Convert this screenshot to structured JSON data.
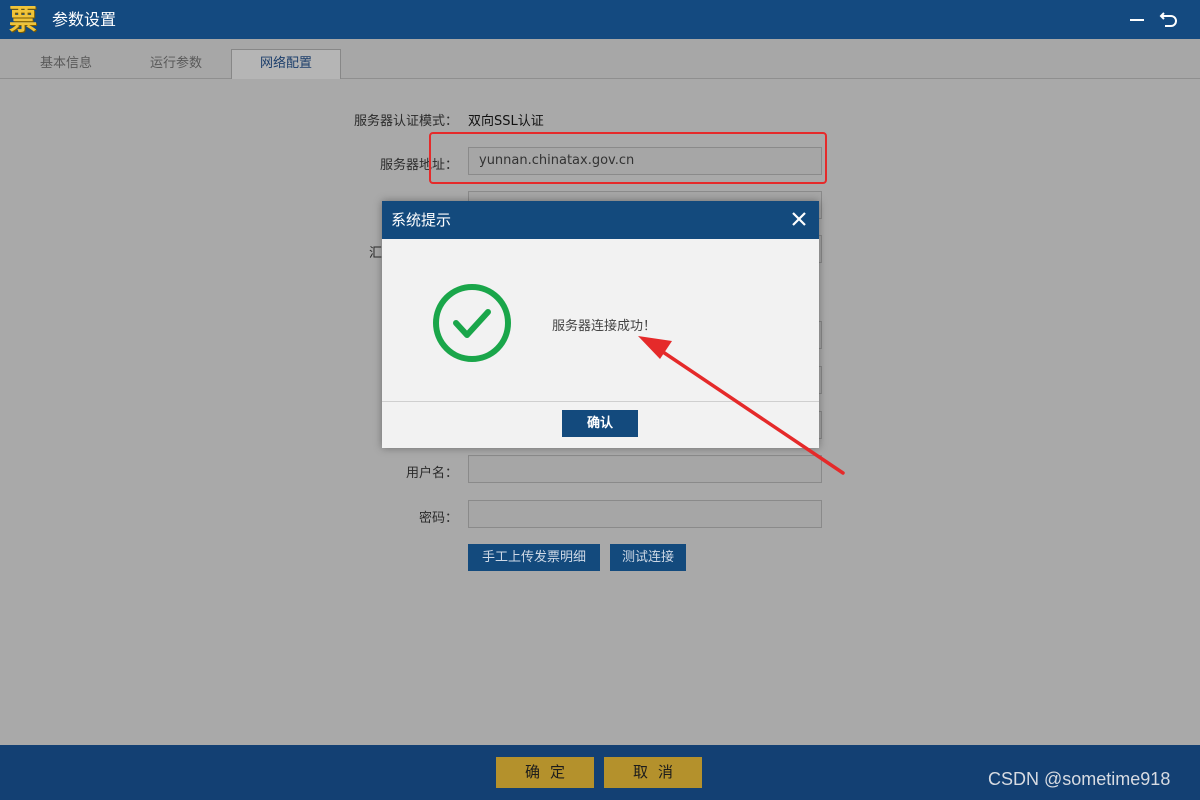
{
  "window": {
    "title": "参数设置",
    "logo_char": "票"
  },
  "tabs": [
    {
      "label": "基本信息",
      "active": false
    },
    {
      "label": "运行参数",
      "active": false
    },
    {
      "label": "网络配置",
      "active": true
    }
  ],
  "form": {
    "auth_mode_label": "服务器认证模式：",
    "auth_mode_value": "双向SSL认证",
    "server_address_label": "服务器地址：",
    "server_address_value": "yunnan.chinatax.gov.cn",
    "partial_label_fragment": "汇",
    "username_label": "用户名：",
    "username_value": "",
    "password_label": "密码：",
    "password_value": "",
    "upload_button": "手工上传发票明细",
    "test_button": "测试连接"
  },
  "dialog": {
    "title": "系统提示",
    "message": "服务器连接成功！",
    "confirm_label": "确认"
  },
  "footer": {
    "ok_label": "确定",
    "cancel_label": "取消"
  },
  "watermark": "CSDN @sometime918",
  "colors": {
    "titlebar": "#144a80",
    "footer": "#134073",
    "primary_button": "#134a7d",
    "footer_button": "#b4912c",
    "success_green": "#1aa64a",
    "annotation_red": "#e52a2a"
  },
  "icons": {
    "minimize": "minimize-icon",
    "restore": "return-icon",
    "close": "close-icon",
    "success": "check-circle-icon"
  }
}
